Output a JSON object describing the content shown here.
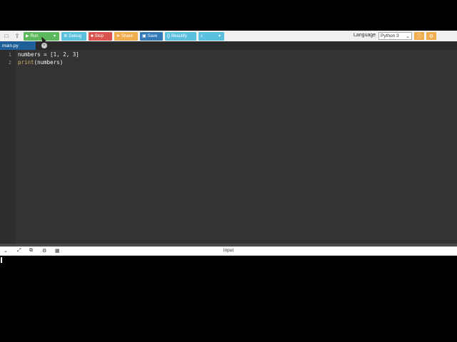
{
  "toolbar": {
    "run_label": "Run",
    "debug_label": "Debug",
    "stop_label": "Stop",
    "share_label": "Share",
    "save_label": "Save",
    "beautify_label": "Beautify"
  },
  "language": {
    "label": "Language",
    "selected": "Python 3"
  },
  "tab": {
    "filename": "main.py"
  },
  "editor": {
    "line_numbers": [
      "1",
      "2"
    ],
    "line1": "numbers = [1, 2, 3]",
    "line2_func": "print",
    "line2_rest": "(numbers)"
  },
  "io": {
    "title": "Input"
  },
  "colors": {
    "run": "#5cb85c",
    "debug": "#5bc0de",
    "stop": "#d9534f",
    "share": "#f0ad4e",
    "save": "#337ab7",
    "tab": "#1f5f99",
    "editor_bg": "#333333"
  }
}
